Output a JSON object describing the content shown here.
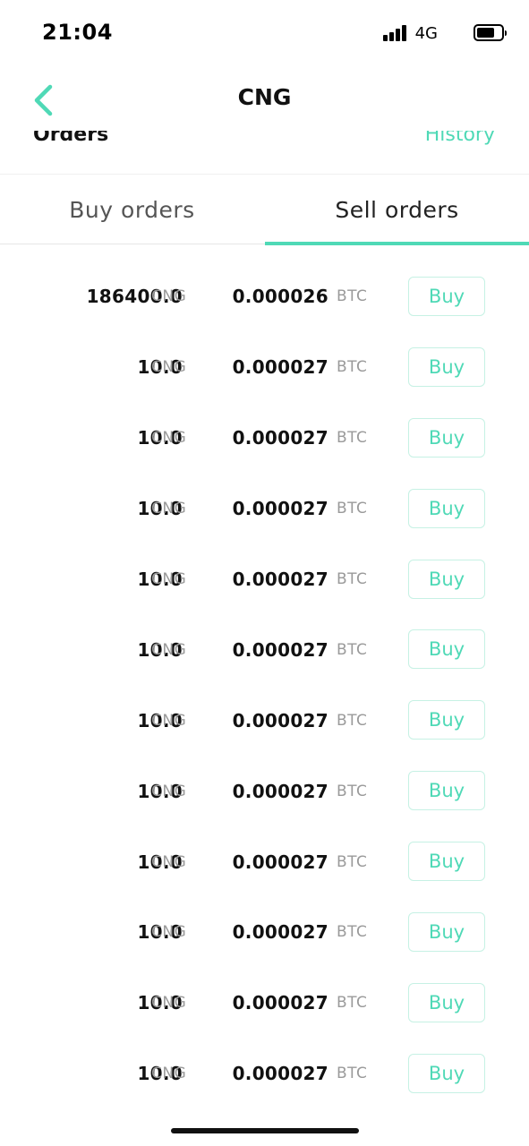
{
  "status": {
    "time": "21:04",
    "network": "4G",
    "icons": [
      "signal-icon",
      "battery-icon"
    ]
  },
  "header": {
    "title": "CNG",
    "back_icon": "chevron-left-icon"
  },
  "section": {
    "left_label": "Orders",
    "right_link": "History"
  },
  "tabs": [
    {
      "label": "Buy orders",
      "active": false
    },
    {
      "label": "Sell orders",
      "active": true
    }
  ],
  "colors": {
    "accent": "#4fd9b6",
    "muted": "#9a9a9a"
  },
  "orders": [
    {
      "amount": "186400.0",
      "amount_unit": "CNG",
      "price": "0.000026",
      "price_unit": "BTC",
      "action": "Buy"
    },
    {
      "amount": "10.0",
      "amount_unit": "CNG",
      "price": "0.000027",
      "price_unit": "BTC",
      "action": "Buy"
    },
    {
      "amount": "10.0",
      "amount_unit": "CNG",
      "price": "0.000027",
      "price_unit": "BTC",
      "action": "Buy"
    },
    {
      "amount": "10.0",
      "amount_unit": "CNG",
      "price": "0.000027",
      "price_unit": "BTC",
      "action": "Buy"
    },
    {
      "amount": "10.0",
      "amount_unit": "CNG",
      "price": "0.000027",
      "price_unit": "BTC",
      "action": "Buy"
    },
    {
      "amount": "10.0",
      "amount_unit": "CNG",
      "price": "0.000027",
      "price_unit": "BTC",
      "action": "Buy"
    },
    {
      "amount": "10.0",
      "amount_unit": "CNG",
      "price": "0.000027",
      "price_unit": "BTC",
      "action": "Buy"
    },
    {
      "amount": "10.0",
      "amount_unit": "CNG",
      "price": "0.000027",
      "price_unit": "BTC",
      "action": "Buy"
    },
    {
      "amount": "10.0",
      "amount_unit": "CNG",
      "price": "0.000027",
      "price_unit": "BTC",
      "action": "Buy"
    },
    {
      "amount": "10.0",
      "amount_unit": "CNG",
      "price": "0.000027",
      "price_unit": "BTC",
      "action": "Buy"
    },
    {
      "amount": "10.0",
      "amount_unit": "CNG",
      "price": "0.000027",
      "price_unit": "BTC",
      "action": "Buy"
    },
    {
      "amount": "10.0",
      "amount_unit": "CNG",
      "price": "0.000027",
      "price_unit": "BTC",
      "action": "Buy"
    }
  ]
}
